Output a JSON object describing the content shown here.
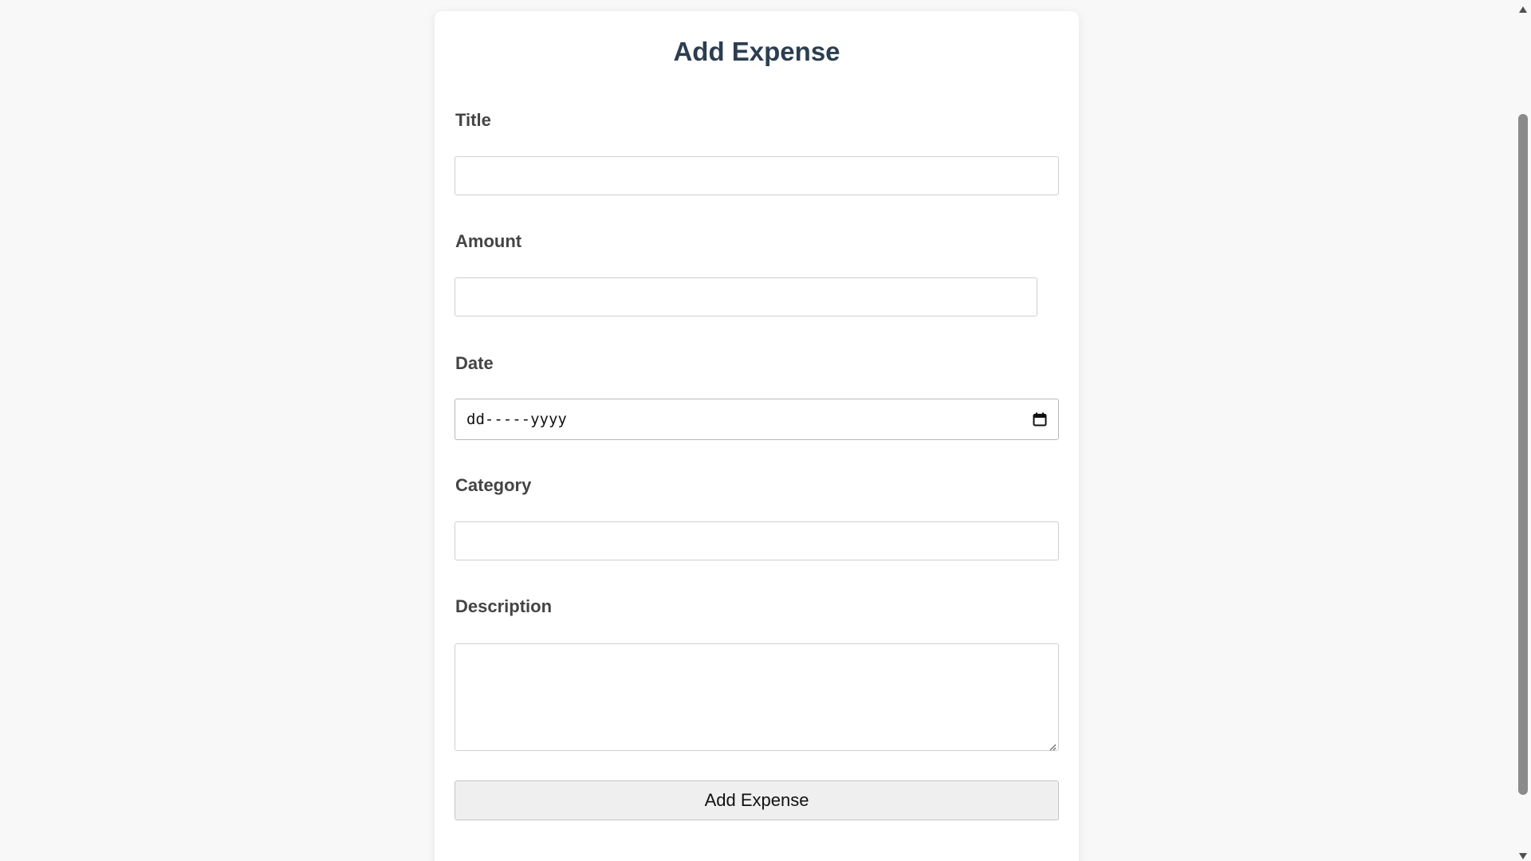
{
  "form": {
    "title": "Add Expense",
    "fields": {
      "title_label": "Title",
      "title_value": "",
      "amount_label": "Amount",
      "amount_value": "",
      "date_label": "Date",
      "date_placeholder": "dd-----yyyy",
      "category_label": "Category",
      "category_value": "",
      "description_label": "Description",
      "description_value": ""
    },
    "submit_label": "Add Expense"
  },
  "icons": {
    "date_picker": "calendar-icon",
    "scroll_up": "scroll-up-arrow-icon",
    "scroll_down": "scroll-down-arrow-icon",
    "resize": "resize-grip-icon"
  },
  "colors": {
    "title": "#2c3e50",
    "label": "#444444",
    "page_background": "#f8f8f8",
    "card_background": "#ffffff"
  }
}
